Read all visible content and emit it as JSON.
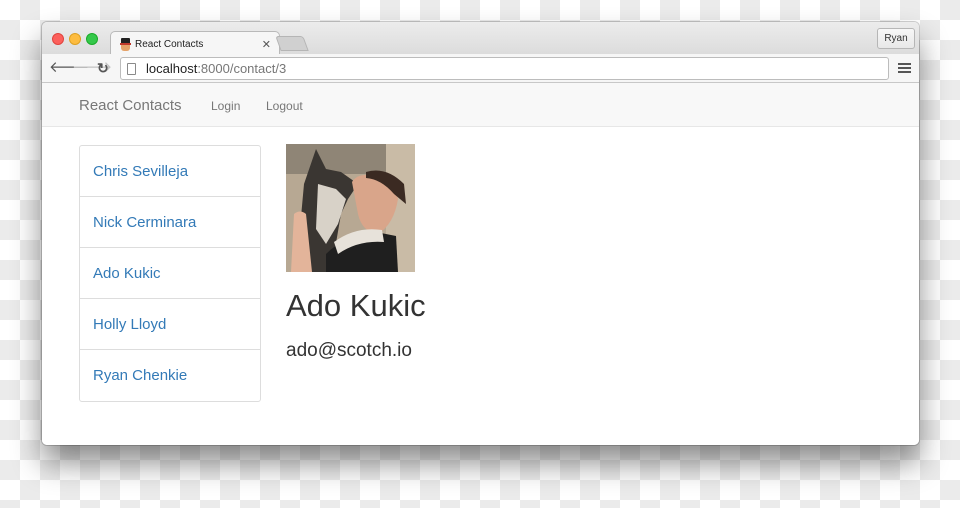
{
  "browser": {
    "tab_title": "React Contacts",
    "tab_favicon": "react-contacts-favicon",
    "profile_name": "Ryan",
    "url_host": "localhost",
    "url_path": ":8000/contact/3"
  },
  "navbar": {
    "brand": "React Contacts",
    "links": [
      "Login",
      "Logout"
    ]
  },
  "contacts": [
    {
      "name": "Chris Sevilleja"
    },
    {
      "name": "Nick Cerminara"
    },
    {
      "name": "Ado Kukic"
    },
    {
      "name": "Holly Lloyd"
    },
    {
      "name": "Ryan Chenkie"
    }
  ],
  "selected_contact": {
    "name": "Ado Kukic",
    "email": "ado@scotch.io",
    "photo_alt": "Man holding a husky dog"
  },
  "colors": {
    "link": "#337ab7",
    "text": "#333333",
    "navbar_bg": "#f8f8f8"
  }
}
